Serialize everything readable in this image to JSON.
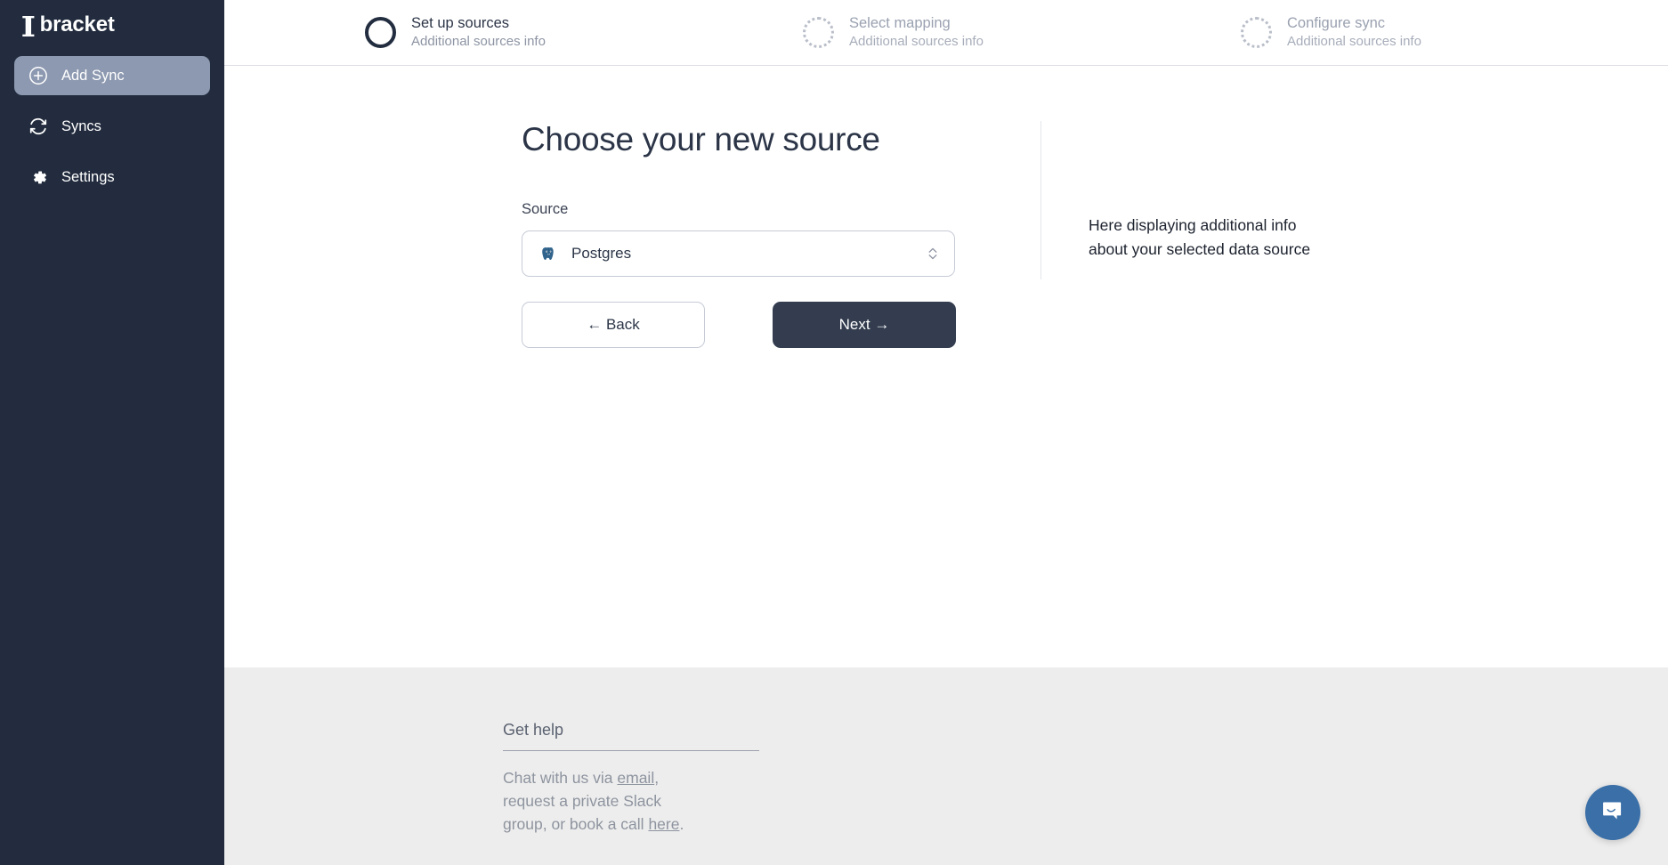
{
  "sidebar": {
    "logo_brackets": "][",
    "logo_text": "bracket",
    "items": [
      {
        "label": "Add Sync",
        "icon": "plus-circle-icon",
        "active": true
      },
      {
        "label": "Syncs",
        "icon": "sync-icon",
        "active": false
      },
      {
        "label": "Settings",
        "icon": "gear-icon",
        "active": false
      }
    ]
  },
  "stepper": {
    "steps": [
      {
        "title": "Set up sources",
        "subtitle": "Additional sources info",
        "state": "active"
      },
      {
        "title": "Select mapping",
        "subtitle": "Additional sources info",
        "state": "inactive"
      },
      {
        "title": "Configure sync",
        "subtitle": "Additional sources info",
        "state": "inactive"
      }
    ]
  },
  "main": {
    "page_title": "Choose your new source",
    "source_field": {
      "label": "Source",
      "selected_value": "Postgres",
      "icon": "postgres-elephant-icon"
    },
    "buttons": {
      "back": "← Back",
      "next": "Next →"
    },
    "info_panel": {
      "line1": "Here displaying additional info",
      "line2": "about your selected data source"
    }
  },
  "footer": {
    "help_title": "Get help",
    "help_parts": {
      "p1": "Chat with us via ",
      "link1": "email",
      "p2": ", request a private Slack group, or book a call ",
      "link2": "here",
      "p3": "."
    }
  },
  "chat": {
    "widget_label": "chat-launcher"
  },
  "colors": {
    "sidebar_bg": "#222c3e",
    "sidebar_active": "#8d99b0",
    "primary_button": "#333d4f",
    "footer_bg": "#ededed",
    "chat_blue": "#3a6fa8",
    "text_dark": "#2b3547",
    "text_muted": "#8e949f"
  }
}
